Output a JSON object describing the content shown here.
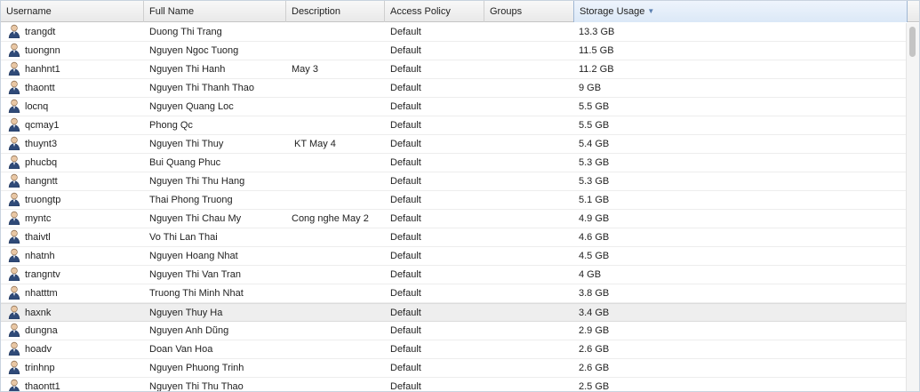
{
  "columns": [
    {
      "label": "Username"
    },
    {
      "label": "Full Name"
    },
    {
      "label": "Description"
    },
    {
      "label": "Access Policy"
    },
    {
      "label": "Groups"
    },
    {
      "label": "Storage Usage",
      "sorted": "desc"
    }
  ],
  "icons": {
    "user": "user-icon",
    "sort": "sort-desc-icon"
  },
  "rows": [
    {
      "username": "trangdt",
      "fullname": "Duong Thi Trang",
      "description": "",
      "policy": "Default",
      "groups": "",
      "storage": "13.3 GB"
    },
    {
      "username": "tuongnn",
      "fullname": "Nguyen Ngoc Tuong",
      "description": "",
      "policy": "Default",
      "groups": "",
      "storage": "11.5 GB"
    },
    {
      "username": "hanhnt1",
      "fullname": "Nguyen Thi Hanh",
      "description": "May 3",
      "policy": "Default",
      "groups": "",
      "storage": "11.2 GB"
    },
    {
      "username": "thaontt",
      "fullname": "Nguyen Thi Thanh Thao",
      "description": "",
      "policy": "Default",
      "groups": "",
      "storage": "9 GB"
    },
    {
      "username": "locnq",
      "fullname": "Nguyen Quang Loc",
      "description": "",
      "policy": "Default",
      "groups": "",
      "storage": "5.5 GB"
    },
    {
      "username": "qcmay1",
      "fullname": "Phong Qc",
      "description": "",
      "policy": "Default",
      "groups": "",
      "storage": "5.5 GB"
    },
    {
      "username": "thuynt3",
      "fullname": "Nguyen Thi Thuy",
      "description": " KT May 4",
      "policy": "Default",
      "groups": "",
      "storage": "5.4 GB"
    },
    {
      "username": "phucbq",
      "fullname": "Bui Quang Phuc",
      "description": "",
      "policy": "Default",
      "groups": "",
      "storage": "5.3 GB"
    },
    {
      "username": "hangntt",
      "fullname": "Nguyen Thi Thu Hang",
      "description": "",
      "policy": "Default",
      "groups": "",
      "storage": "5.3 GB"
    },
    {
      "username": "truongtp",
      "fullname": "Thai Phong Truong",
      "description": "",
      "policy": "Default",
      "groups": "",
      "storage": "5.1 GB"
    },
    {
      "username": "myntc",
      "fullname": "Nguyen Thi Chau My",
      "description": "Cong nghe May 2",
      "policy": "Default",
      "groups": "",
      "storage": "4.9 GB"
    },
    {
      "username": "thaivtl",
      "fullname": "Vo Thi Lan Thai",
      "description": "",
      "policy": "Default",
      "groups": "",
      "storage": "4.6 GB"
    },
    {
      "username": "nhatnh",
      "fullname": "Nguyen Hoang Nhat",
      "description": "",
      "policy": "Default",
      "groups": "",
      "storage": "4.5 GB"
    },
    {
      "username": "trangntv",
      "fullname": "Nguyen Thi Van Tran",
      "description": "",
      "policy": "Default",
      "groups": "",
      "storage": "4 GB"
    },
    {
      "username": "nhatttm",
      "fullname": "Truong Thi Minh Nhat",
      "description": "",
      "policy": "Default",
      "groups": "",
      "storage": "3.8 GB"
    },
    {
      "username": "haxnk",
      "fullname": "Nguyen Thuy Ha",
      "description": "",
      "policy": "Default",
      "groups": "",
      "storage": "3.4 GB",
      "hover": true
    },
    {
      "username": "dungna",
      "fullname": "Nguyen Anh Dũng",
      "description": "",
      "policy": "Default",
      "groups": "",
      "storage": "2.9 GB"
    },
    {
      "username": "hoadv",
      "fullname": "Doan Van Hoa",
      "description": "",
      "policy": "Default",
      "groups": "",
      "storage": "2.6 GB"
    },
    {
      "username": "trinhnp",
      "fullname": "Nguyen Phuong Trinh",
      "description": "",
      "policy": "Default",
      "groups": "",
      "storage": "2.6 GB"
    },
    {
      "username": "thaontt1",
      "fullname": "Nguyen Thi Thu Thao",
      "description": "",
      "policy": "Default",
      "groups": "",
      "storage": "2.5 GB"
    }
  ]
}
